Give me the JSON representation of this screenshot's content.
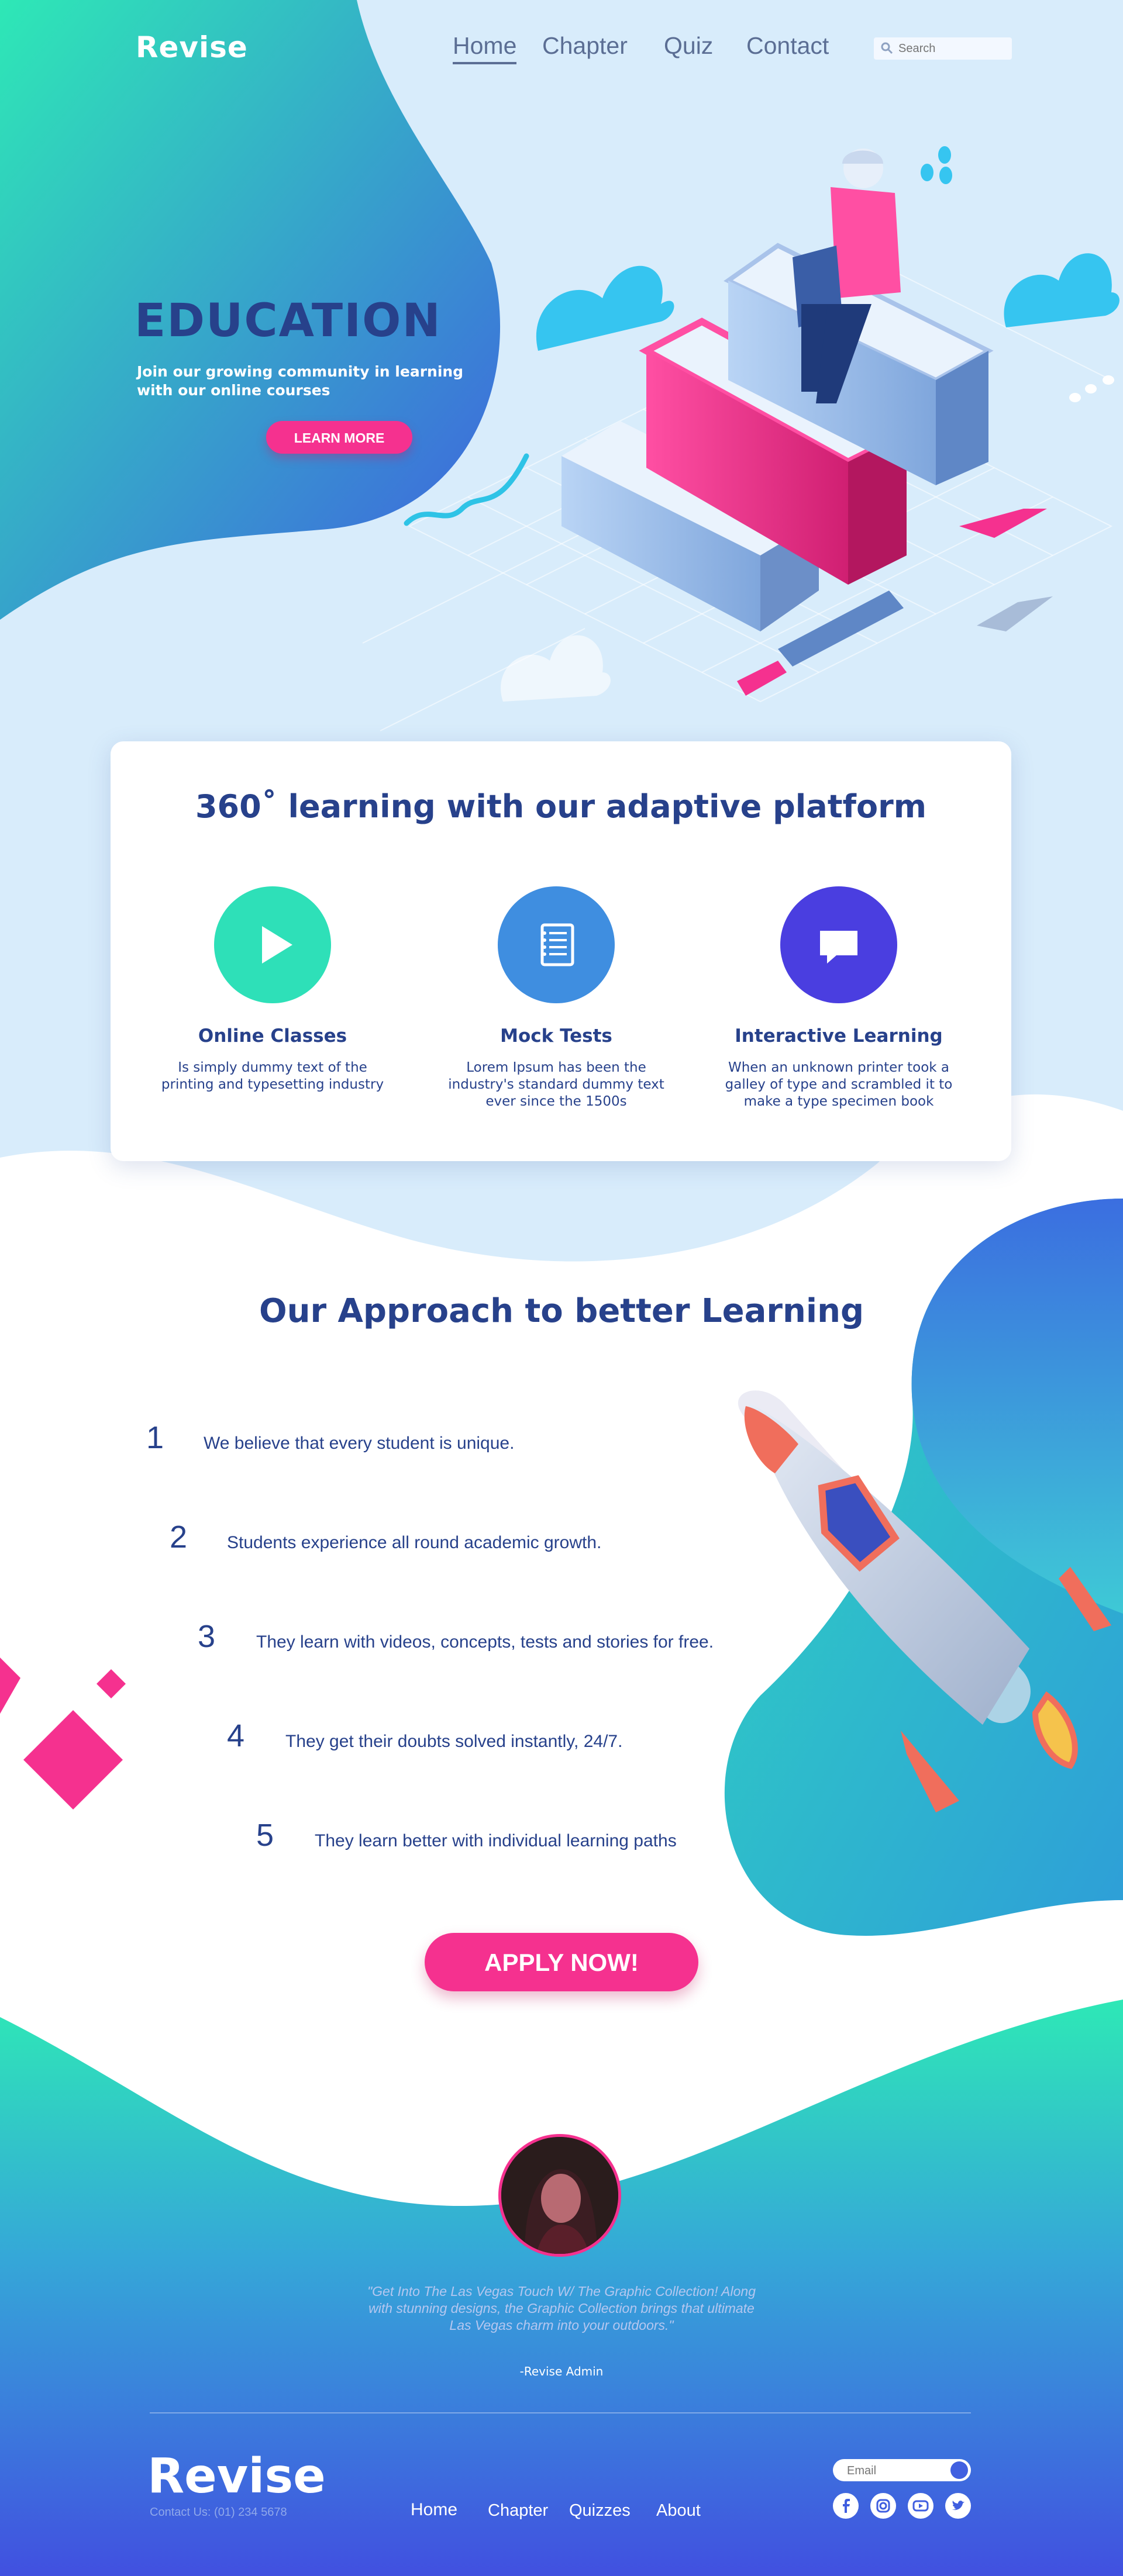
{
  "nav": {
    "logo": "Revise",
    "links": [
      "Home",
      "Chapter",
      "Quiz",
      "Contact"
    ],
    "search_placeholder": "Search"
  },
  "hero": {
    "title": "EDUCATION",
    "subtitle": "Join our growing community in learning with our online courses",
    "button": "LEARN MORE"
  },
  "features": {
    "title": "360˚ learning with our adaptive platform",
    "items": [
      {
        "title": "Online Classes",
        "text": "Is simply dummy text of the printing and typesetting industry",
        "icon": "play-icon",
        "color": "#2ee0b8"
      },
      {
        "title": "Mock Tests",
        "text": "Lorem Ipsum has been the industry's standard dummy text ever since the 1500s",
        "icon": "notebook-icon",
        "color": "#3f8ee0"
      },
      {
        "title": "Interactive Learning",
        "text": "When an unknown printer took a galley of type and scrambled it to make a type specimen book",
        "icon": "chat-icon",
        "color": "#4a3ee0"
      }
    ]
  },
  "approach": {
    "title": "Our Approach to better Learning",
    "steps": [
      {
        "num": "1",
        "text": "We believe that every student is unique."
      },
      {
        "num": "2",
        "text": "Students experience all round academic growth."
      },
      {
        "num": "3",
        "text": "They learn with videos, concepts, tests and stories for free."
      },
      {
        "num": "4",
        "text": "They get their doubts solved instantly, 24/7."
      },
      {
        "num": "5",
        "text": "They learn better with individual learning paths"
      }
    ],
    "button": "APPLY NOW!"
  },
  "testimonial": {
    "quote": "\"Get Into The Las Vegas Touch W/ The Graphic Collection! Along with stunning designs, the Graphic Collection brings that ultimate Las Vegas charm into your outdoors.\"",
    "author": "-Revise Admin"
  },
  "footer": {
    "logo": "Revise",
    "contact": "Contact Us: (01) 234 5678",
    "links": [
      "Home",
      "Chapter",
      "Quizzes",
      "About"
    ],
    "email_placeholder": "Email",
    "social": [
      "facebook-icon",
      "instagram-icon",
      "youtube-icon",
      "twitter-icon"
    ]
  },
  "colors": {
    "navy": "#27418b",
    "pink": "#f5318f",
    "teal": "#2ee8b6",
    "blue": "#3f5ee0",
    "sky": "#d8ecfb"
  }
}
